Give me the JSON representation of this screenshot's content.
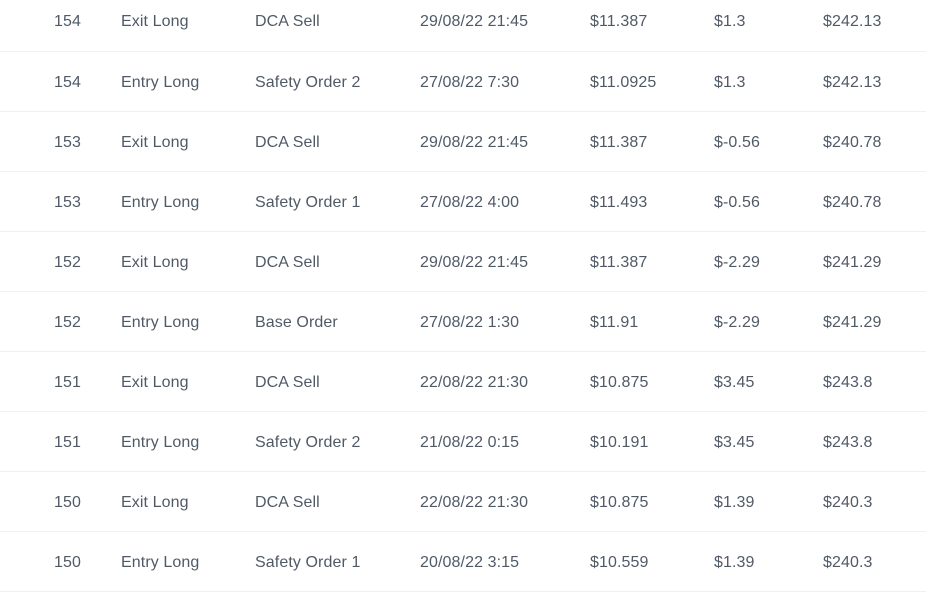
{
  "trades": [
    {
      "id": "154",
      "type": "Exit Long",
      "signal": "DCA Sell",
      "date": "29/08/22 21:45",
      "price": "$11.387",
      "pl": "$1.3",
      "balance": "$242.13"
    },
    {
      "id": "154",
      "type": "Entry Long",
      "signal": "Safety Order 2",
      "date": "27/08/22 7:30",
      "price": "$11.0925",
      "pl": "$1.3",
      "balance": "$242.13"
    },
    {
      "id": "153",
      "type": "Exit Long",
      "signal": "DCA Sell",
      "date": "29/08/22 21:45",
      "price": "$11.387",
      "pl": "$-0.56",
      "balance": "$240.78"
    },
    {
      "id": "153",
      "type": "Entry Long",
      "signal": "Safety Order 1",
      "date": "27/08/22 4:00",
      "price": "$11.493",
      "pl": "$-0.56",
      "balance": "$240.78"
    },
    {
      "id": "152",
      "type": "Exit Long",
      "signal": "DCA Sell",
      "date": "29/08/22 21:45",
      "price": "$11.387",
      "pl": "$-2.29",
      "balance": "$241.29"
    },
    {
      "id": "152",
      "type": "Entry Long",
      "signal": "Base Order",
      "date": "27/08/22 1:30",
      "price": "$11.91",
      "pl": "$-2.29",
      "balance": "$241.29"
    },
    {
      "id": "151",
      "type": "Exit Long",
      "signal": "DCA Sell",
      "date": "22/08/22 21:30",
      "price": "$10.875",
      "pl": "$3.45",
      "balance": "$243.8"
    },
    {
      "id": "151",
      "type": "Entry Long",
      "signal": "Safety Order 2",
      "date": "21/08/22 0:15",
      "price": "$10.191",
      "pl": "$3.45",
      "balance": "$243.8"
    },
    {
      "id": "150",
      "type": "Exit Long",
      "signal": "DCA Sell",
      "date": "22/08/22 21:30",
      "price": "$10.875",
      "pl": "$1.39",
      "balance": "$240.3"
    },
    {
      "id": "150",
      "type": "Entry Long",
      "signal": "Safety Order 1",
      "date": "20/08/22 3:15",
      "price": "$10.559",
      "pl": "$1.39",
      "balance": "$240.3"
    }
  ]
}
